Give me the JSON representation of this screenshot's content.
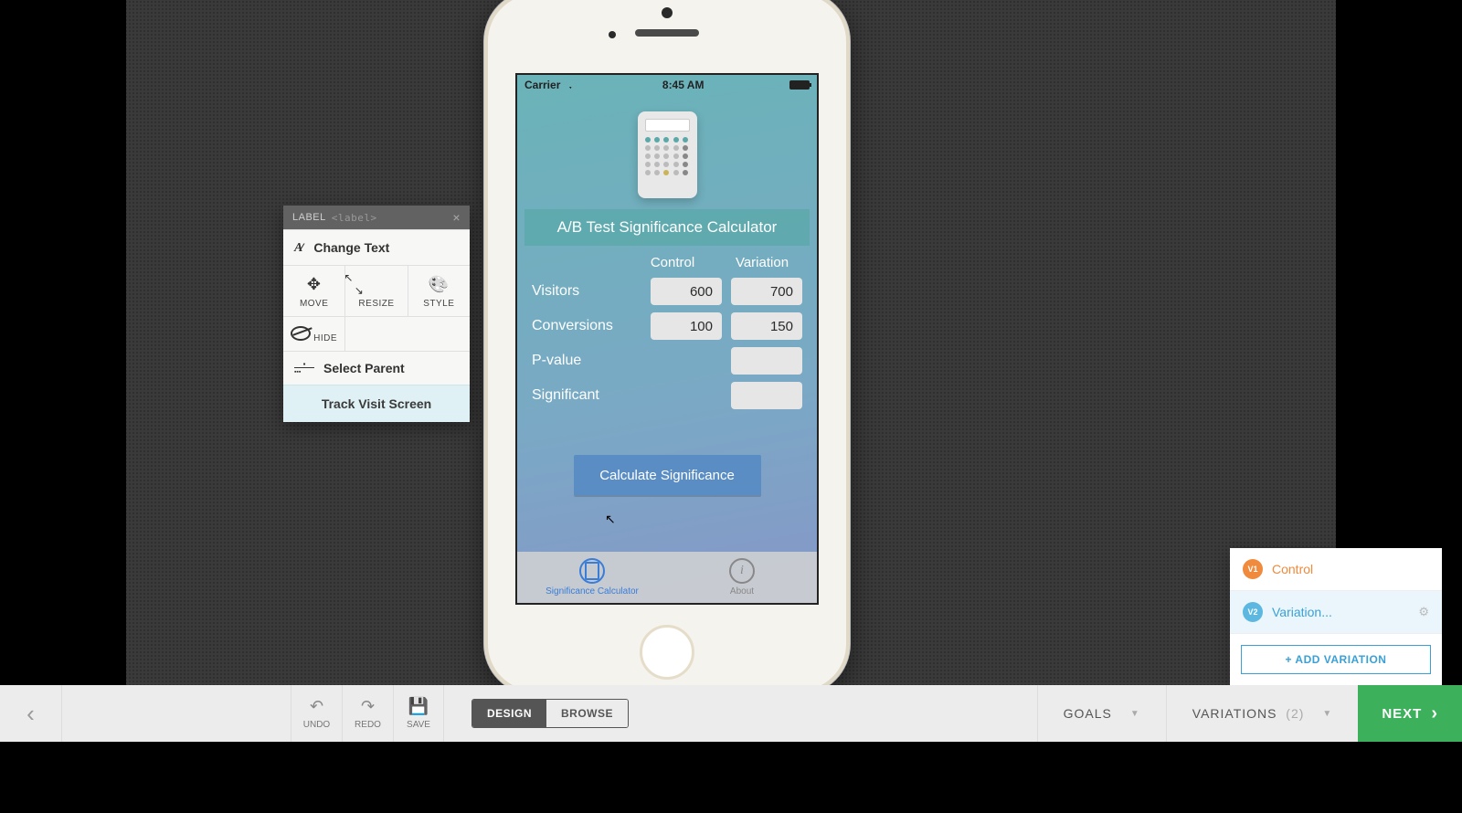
{
  "contextPanel": {
    "title": "LABEL",
    "tag": "<label>",
    "changeText": "Change Text",
    "tools": {
      "move": "MOVE",
      "resize": "RESIZE",
      "style": "STYLE",
      "hide": "HIDE"
    },
    "selectParent": "Select Parent",
    "trackVisit": "Track Visit Screen"
  },
  "phone": {
    "carrier": "Carrier",
    "time": "8:45 AM",
    "appTitle": "A/B Test Significance Calculator",
    "headers": {
      "control": "Control",
      "variation": "Variation"
    },
    "rows": {
      "visitors": {
        "label": "Visitors",
        "control": "600",
        "variation": "700"
      },
      "conversions": {
        "label": "Conversions",
        "control": "100",
        "variation": "150"
      },
      "pvalue": {
        "label": "P-value"
      },
      "significant": {
        "label": "Significant"
      }
    },
    "calcButton": "Calculate Significance",
    "tabs": {
      "calc": "Significance Calculator",
      "about": "About"
    }
  },
  "variationsPanel": {
    "v1": {
      "badge": "V1",
      "label": "Control"
    },
    "v2": {
      "badge": "V2",
      "label": "Variation..."
    },
    "add": "+ ADD VARIATION"
  },
  "bottomBar": {
    "undo": "UNDO",
    "redo": "REDO",
    "save": "SAVE",
    "design": "DESIGN",
    "browse": "BROWSE",
    "goals": "GOALS",
    "variations": "VARIATIONS",
    "variationsCount": "(2)",
    "next": "NEXT"
  }
}
